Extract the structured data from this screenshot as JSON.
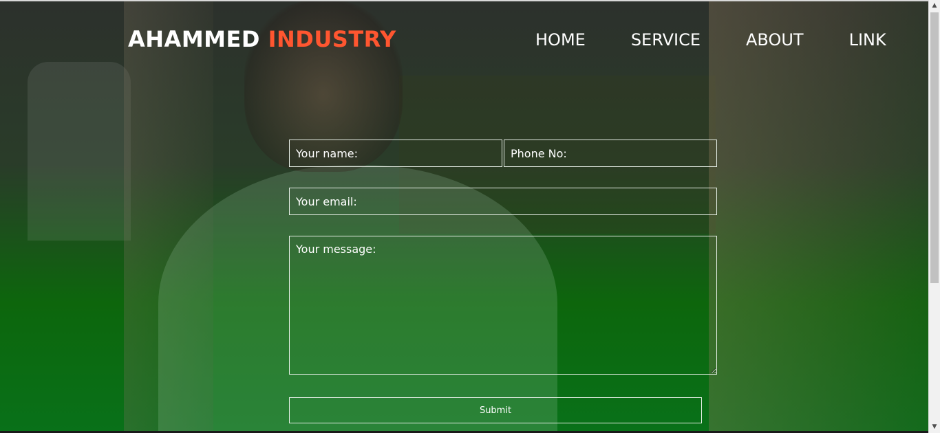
{
  "brand": {
    "primary": "AHAMMED",
    "accent": "INDUSTRY",
    "accent_color": "#ff5630"
  },
  "nav": {
    "items": [
      "HOME",
      "SERVICE",
      "ABOUT",
      "LINK"
    ]
  },
  "form": {
    "name_placeholder": "Your name:",
    "phone_placeholder": "Phone No:",
    "email_placeholder": "Your email:",
    "message_placeholder": "Your message:",
    "submit_label": "Submit"
  },
  "icons": {
    "scroll_up": "chevron-up-icon",
    "scroll_down": "chevron-down-icon"
  }
}
